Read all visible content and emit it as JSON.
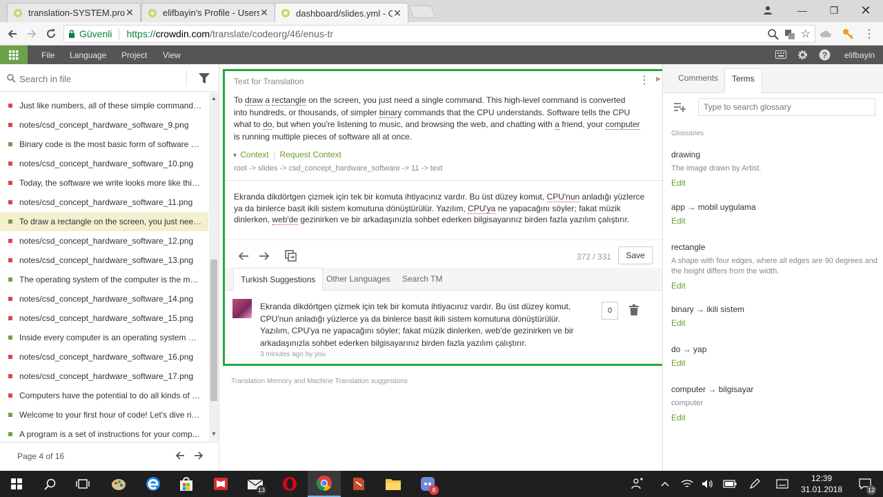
{
  "browser": {
    "tabs": [
      {
        "title": "translation-SYSTEM.prop"
      },
      {
        "title": "elifbayin's Profile - Users"
      },
      {
        "title": "dashboard/slides.yml - C"
      }
    ],
    "secure_label": "Güvenli",
    "url_scheme": "https://",
    "url_host": "crowdin.com",
    "url_path": "/translate/codeorg/46/enus-tr"
  },
  "app": {
    "menu": [
      "File",
      "Language",
      "Project",
      "View"
    ],
    "username": "elifbayin"
  },
  "left": {
    "search_placeholder": "Search in file",
    "strings": [
      {
        "text": "Just like numbers, all of these simple commands ca...",
        "status": "red"
      },
      {
        "text": "notes/csd_concept_hardware_software_9.png",
        "status": "red"
      },
      {
        "text": "Binary code is the most basic form of software and i...",
        "status": "green"
      },
      {
        "text": "notes/csd_concept_hardware_software_10.png",
        "status": "red"
      },
      {
        "text": "Today, the software we write looks more like this (P...",
        "status": "red"
      },
      {
        "text": "notes/csd_concept_hardware_software_11.png",
        "status": "red"
      },
      {
        "text": "To draw a rectangle on the screen, you just need a s...",
        "status": "green",
        "selected": true
      },
      {
        "text": "notes/csd_concept_hardware_software_12.png",
        "status": "red"
      },
      {
        "text": "notes/csd_concept_hardware_software_13.png",
        "status": "red"
      },
      {
        "text": "The operating system of the computer is the master...",
        "status": "green"
      },
      {
        "text": "notes/csd_concept_hardware_software_14.png",
        "status": "red"
      },
      {
        "text": "notes/csd_concept_hardware_software_15.png",
        "status": "red"
      },
      {
        "text": "Inside every computer is an operating system mana...",
        "status": "green"
      },
      {
        "text": "notes/csd_concept_hardware_software_16.png",
        "status": "red"
      },
      {
        "text": "notes/csd_concept_hardware_software_17.png",
        "status": "red"
      },
      {
        "text": "Computers have the potential to do all kinds of ama...",
        "status": "red"
      },
      {
        "text": "Welcome to your first hour of code! Let's dive rig...",
        "status": "green"
      },
      {
        "text": "A program is a set of instructions for your comp...",
        "status": "green"
      }
    ],
    "pager": "Page 4 of 16"
  },
  "editor": {
    "source_label": "Text for Translation",
    "source_parts": [
      {
        "t": "To "
      },
      {
        "t": "draw",
        "u": true
      },
      {
        "t": " "
      },
      {
        "t": "a",
        "u": true
      },
      {
        "t": " "
      },
      {
        "t": "rectangle",
        "u": true
      },
      {
        "t": " on the screen, you just need a single command. This high-level command is converted into hundreds, or thousands, of simpler "
      },
      {
        "t": "binary",
        "u": true
      },
      {
        "t": " commands that the CPU understands. Software tells the CPU what to "
      },
      {
        "t": "do",
        "u": true
      },
      {
        "t": ", but when you're listening to music, and browsing the web, and chatting with "
      },
      {
        "t": "a",
        "u": true
      },
      {
        "t": " friend, your "
      },
      {
        "t": "computer",
        "u": true
      },
      {
        "t": " is running multiple pieces of software all at once."
      }
    ],
    "context_label": "Context",
    "request_context": "Request Context",
    "context_path": "root -> slides -> csd_concept_hardware_software -> 11 -> text",
    "translation_parts": [
      {
        "t": "Ekranda dikdörtgen çizmek için tek bir komuta ihtiyacınız vardır. Bu üst düzey komut, "
      },
      {
        "t": "CPU'nun",
        "u": true
      },
      {
        "t": " anladığı yüzlerce ya da binlerce basit ikili sistem komutuna dönüştürülür. Yazılım, "
      },
      {
        "t": "CPU'ya",
        "u": true
      },
      {
        "t": " ne yapacağını söyler; fakat müzik dinlerken, "
      },
      {
        "t": "web'de",
        "u": true
      },
      {
        "t": " gezinirken ve bir arkadaşınızla sohbet ederken bilgisayarınız birden fazla yazılım çalıştırır."
      }
    ],
    "char_count": "372 / 331",
    "save_label": "Save",
    "suggestion_tabs": [
      "Turkish Suggestions",
      "Other Languages",
      "Search TM"
    ],
    "suggestion_text": "Ekranda dikdörtgen çizmek için tek bir komuta ihtiyacınız vardır. Bu üst düzey komut, CPU'nun anladığı yüzlerce ya da binlerce basit ikili sistem komutuna dönüştürülür. Yazılım, CPU'ya ne yapacağını söyler; fakat müzik dinlerken, web'de gezinirken ve bir arkadaşınızla sohbet ederken bilgisayarınız birden fazla yazılım çalıştırır.",
    "suggestion_meta": "3 minutes ago by you",
    "votes": "0",
    "tm_note": "Translation Memory and Machine Translation suggestions"
  },
  "right": {
    "tabs": [
      "Comments",
      "Terms"
    ],
    "glossary_placeholder": "Type to search glossary",
    "glossaries_label": "Glossaries",
    "edit_label": "Edit",
    "terms": [
      {
        "name": "drawing",
        "desc": "The image drawn by Artist."
      },
      {
        "name": "app → mobil uygulama",
        "desc": ""
      },
      {
        "name": "rectangle",
        "desc": "A shape with four edges, where all edges are 90 degrees and the height differs from the width."
      },
      {
        "name": "binary → ikili sistem",
        "desc": ""
      },
      {
        "name": "do → yap",
        "desc": ""
      },
      {
        "name": "computer → bilgisayar",
        "desc": "computer"
      }
    ]
  },
  "taskbar": {
    "mail_badge": "13",
    "discord_badge": "8",
    "notif_badge": "12",
    "time": "12:39",
    "date": "31.01.2018"
  },
  "colors": {
    "accent_green": "#26a641",
    "status_red": "#e0454a",
    "status_green": "#6ea24a"
  }
}
